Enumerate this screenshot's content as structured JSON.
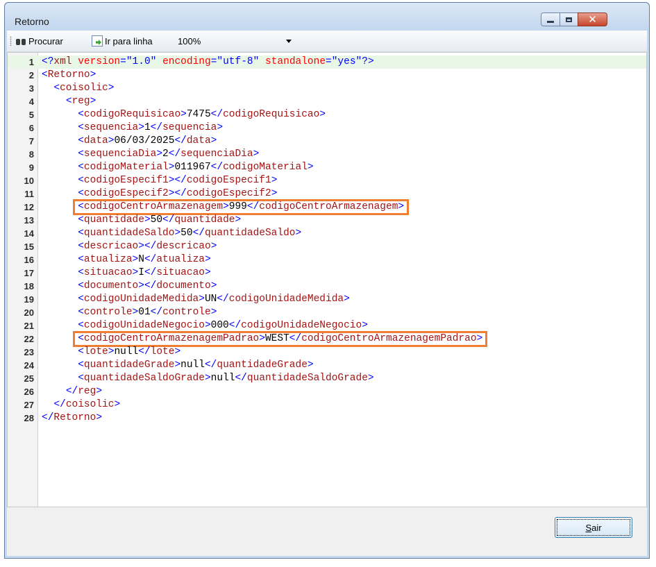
{
  "window": {
    "title": "Retorno"
  },
  "toolbar": {
    "search_label": "Procurar",
    "goto_label": "Ir para linha",
    "zoom_value": "100%"
  },
  "editor": {
    "lines": [
      {
        "n": "1",
        "tokens": [
          [
            "b",
            "<?"
          ],
          [
            "g",
            "xml "
          ],
          [
            "a",
            "version"
          ],
          [
            "b",
            "="
          ],
          [
            "v",
            "\"1.0\" "
          ],
          [
            "a",
            "encoding"
          ],
          [
            "b",
            "="
          ],
          [
            "v",
            "\"utf-8\" "
          ],
          [
            "a",
            "standalone"
          ],
          [
            "b",
            "="
          ],
          [
            "v",
            "\"yes\""
          ],
          [
            "b",
            "?>"
          ]
        ]
      },
      {
        "n": "2",
        "tokens": [
          [
            "i",
            ""
          ],
          [
            "b",
            "<"
          ],
          [
            "g",
            "Retorno"
          ],
          [
            "b",
            ">"
          ]
        ]
      },
      {
        "n": "3",
        "tokens": [
          [
            "i",
            "  "
          ],
          [
            "b",
            "<"
          ],
          [
            "g",
            "coisolic"
          ],
          [
            "b",
            ">"
          ]
        ]
      },
      {
        "n": "4",
        "tokens": [
          [
            "i",
            "    "
          ],
          [
            "b",
            "<"
          ],
          [
            "g",
            "reg"
          ],
          [
            "b",
            ">"
          ]
        ]
      },
      {
        "n": "5",
        "tokens": [
          [
            "i",
            "      "
          ],
          [
            "b",
            "<"
          ],
          [
            "g",
            "codigoRequisicao"
          ],
          [
            "b",
            ">"
          ],
          [
            "t",
            "7475"
          ],
          [
            "b",
            "</"
          ],
          [
            "g",
            "codigoRequisicao"
          ],
          [
            "b",
            ">"
          ]
        ]
      },
      {
        "n": "6",
        "tokens": [
          [
            "i",
            "      "
          ],
          [
            "b",
            "<"
          ],
          [
            "g",
            "sequencia"
          ],
          [
            "b",
            ">"
          ],
          [
            "t",
            "1"
          ],
          [
            "b",
            "</"
          ],
          [
            "g",
            "sequencia"
          ],
          [
            "b",
            ">"
          ]
        ]
      },
      {
        "n": "7",
        "tokens": [
          [
            "i",
            "      "
          ],
          [
            "b",
            "<"
          ],
          [
            "g",
            "data"
          ],
          [
            "b",
            ">"
          ],
          [
            "t",
            "06/03/2025"
          ],
          [
            "b",
            "</"
          ],
          [
            "g",
            "data"
          ],
          [
            "b",
            ">"
          ]
        ]
      },
      {
        "n": "8",
        "tokens": [
          [
            "i",
            "      "
          ],
          [
            "b",
            "<"
          ],
          [
            "g",
            "sequenciaDia"
          ],
          [
            "b",
            ">"
          ],
          [
            "t",
            "2"
          ],
          [
            "b",
            "</"
          ],
          [
            "g",
            "sequenciaDia"
          ],
          [
            "b",
            ">"
          ]
        ]
      },
      {
        "n": "9",
        "tokens": [
          [
            "i",
            "      "
          ],
          [
            "b",
            "<"
          ],
          [
            "g",
            "codigoMaterial"
          ],
          [
            "b",
            ">"
          ],
          [
            "t",
            "011967"
          ],
          [
            "b",
            "</"
          ],
          [
            "g",
            "codigoMaterial"
          ],
          [
            "b",
            ">"
          ]
        ]
      },
      {
        "n": "10",
        "tokens": [
          [
            "i",
            "      "
          ],
          [
            "b",
            "<"
          ],
          [
            "g",
            "codigoEspecif1"
          ],
          [
            "b",
            "></"
          ],
          [
            "g",
            "codigoEspecif1"
          ],
          [
            "b",
            ">"
          ]
        ]
      },
      {
        "n": "11",
        "tokens": [
          [
            "i",
            "      "
          ],
          [
            "b",
            "<"
          ],
          [
            "g",
            "codigoEspecif2"
          ],
          [
            "b",
            "></"
          ],
          [
            "g",
            "codigoEspecif2"
          ],
          [
            "b",
            ">"
          ]
        ]
      },
      {
        "n": "12",
        "tokens": [
          [
            "i",
            "      "
          ],
          [
            "b",
            "<"
          ],
          [
            "g",
            "codigoCentroArmazenagem"
          ],
          [
            "b",
            ">"
          ],
          [
            "t",
            "999"
          ],
          [
            "b",
            "</"
          ],
          [
            "g",
            "codigoCentroArmazenagem"
          ],
          [
            "b",
            ">"
          ]
        ]
      },
      {
        "n": "13",
        "tokens": [
          [
            "i",
            "      "
          ],
          [
            "b",
            "<"
          ],
          [
            "g",
            "quantidade"
          ],
          [
            "b",
            ">"
          ],
          [
            "t",
            "50"
          ],
          [
            "b",
            "</"
          ],
          [
            "g",
            "quantidade"
          ],
          [
            "b",
            ">"
          ]
        ]
      },
      {
        "n": "14",
        "tokens": [
          [
            "i",
            "      "
          ],
          [
            "b",
            "<"
          ],
          [
            "g",
            "quantidadeSaldo"
          ],
          [
            "b",
            ">"
          ],
          [
            "t",
            "50"
          ],
          [
            "b",
            "</"
          ],
          [
            "g",
            "quantidadeSaldo"
          ],
          [
            "b",
            ">"
          ]
        ]
      },
      {
        "n": "15",
        "tokens": [
          [
            "i",
            "      "
          ],
          [
            "b",
            "<"
          ],
          [
            "g",
            "descricao"
          ],
          [
            "b",
            "></"
          ],
          [
            "g",
            "descricao"
          ],
          [
            "b",
            ">"
          ]
        ]
      },
      {
        "n": "16",
        "tokens": [
          [
            "i",
            "      "
          ],
          [
            "b",
            "<"
          ],
          [
            "g",
            "atualiza"
          ],
          [
            "b",
            ">"
          ],
          [
            "t",
            "N"
          ],
          [
            "b",
            "</"
          ],
          [
            "g",
            "atualiza"
          ],
          [
            "b",
            ">"
          ]
        ]
      },
      {
        "n": "17",
        "tokens": [
          [
            "i",
            "      "
          ],
          [
            "b",
            "<"
          ],
          [
            "g",
            "situacao"
          ],
          [
            "b",
            ">"
          ],
          [
            "t",
            "I"
          ],
          [
            "b",
            "</"
          ],
          [
            "g",
            "situacao"
          ],
          [
            "b",
            ">"
          ]
        ]
      },
      {
        "n": "18",
        "tokens": [
          [
            "i",
            "      "
          ],
          [
            "b",
            "<"
          ],
          [
            "g",
            "documento"
          ],
          [
            "b",
            "></"
          ],
          [
            "g",
            "documento"
          ],
          [
            "b",
            ">"
          ]
        ]
      },
      {
        "n": "19",
        "tokens": [
          [
            "i",
            "      "
          ],
          [
            "b",
            "<"
          ],
          [
            "g",
            "codigoUnidadeMedida"
          ],
          [
            "b",
            ">"
          ],
          [
            "t",
            "UN"
          ],
          [
            "b",
            "</"
          ],
          [
            "g",
            "codigoUnidadeMedida"
          ],
          [
            "b",
            ">"
          ]
        ]
      },
      {
        "n": "20",
        "tokens": [
          [
            "i",
            "      "
          ],
          [
            "b",
            "<"
          ],
          [
            "g",
            "controle"
          ],
          [
            "b",
            ">"
          ],
          [
            "t",
            "01"
          ],
          [
            "b",
            "</"
          ],
          [
            "g",
            "controle"
          ],
          [
            "b",
            ">"
          ]
        ]
      },
      {
        "n": "21",
        "tokens": [
          [
            "i",
            "      "
          ],
          [
            "b",
            "<"
          ],
          [
            "g",
            "codigoUnidadeNegocio"
          ],
          [
            "b",
            ">"
          ],
          [
            "t",
            "000"
          ],
          [
            "b",
            "</"
          ],
          [
            "g",
            "codigoUnidadeNegocio"
          ],
          [
            "b",
            ">"
          ]
        ]
      },
      {
        "n": "22",
        "tokens": [
          [
            "i",
            "      "
          ],
          [
            "b",
            "<"
          ],
          [
            "g",
            "codigoCentroArmazenagemPadrao"
          ],
          [
            "b",
            ">"
          ],
          [
            "t",
            "WEST"
          ],
          [
            "b",
            "</"
          ],
          [
            "g",
            "codigoCentroArmazenagemPadrao"
          ],
          [
            "b",
            ">"
          ]
        ]
      },
      {
        "n": "23",
        "tokens": [
          [
            "i",
            "      "
          ],
          [
            "b",
            "<"
          ],
          [
            "g",
            "lote"
          ],
          [
            "b",
            ">"
          ],
          [
            "t",
            "null"
          ],
          [
            "b",
            "</"
          ],
          [
            "g",
            "lote"
          ],
          [
            "b",
            ">"
          ]
        ]
      },
      {
        "n": "24",
        "tokens": [
          [
            "i",
            "      "
          ],
          [
            "b",
            "<"
          ],
          [
            "g",
            "quantidadeGrade"
          ],
          [
            "b",
            ">"
          ],
          [
            "t",
            "null"
          ],
          [
            "b",
            "</"
          ],
          [
            "g",
            "quantidadeGrade"
          ],
          [
            "b",
            ">"
          ]
        ]
      },
      {
        "n": "25",
        "tokens": [
          [
            "i",
            "      "
          ],
          [
            "b",
            "<"
          ],
          [
            "g",
            "quantidadeSaldoGrade"
          ],
          [
            "b",
            ">"
          ],
          [
            "t",
            "null"
          ],
          [
            "b",
            "</"
          ],
          [
            "g",
            "quantidadeSaldoGrade"
          ],
          [
            "b",
            ">"
          ]
        ]
      },
      {
        "n": "26",
        "tokens": [
          [
            "i",
            "    "
          ],
          [
            "b",
            "</"
          ],
          [
            "g",
            "reg"
          ],
          [
            "b",
            ">"
          ]
        ]
      },
      {
        "n": "27",
        "tokens": [
          [
            "i",
            "  "
          ],
          [
            "b",
            "</"
          ],
          [
            "g",
            "coisolic"
          ],
          [
            "b",
            ">"
          ]
        ]
      },
      {
        "n": "28",
        "tokens": [
          [
            "i",
            ""
          ],
          [
            "b",
            "</"
          ],
          [
            "g",
            "Retorno"
          ],
          [
            "b",
            ">"
          ]
        ]
      }
    ],
    "highlighted_lines": [
      "12",
      "22"
    ],
    "highlight_color": "#f07d34",
    "current_line_color": "#e9f7e6"
  },
  "footer": {
    "exit_prefix": "",
    "exit_accel": "S",
    "exit_rest": "air"
  }
}
